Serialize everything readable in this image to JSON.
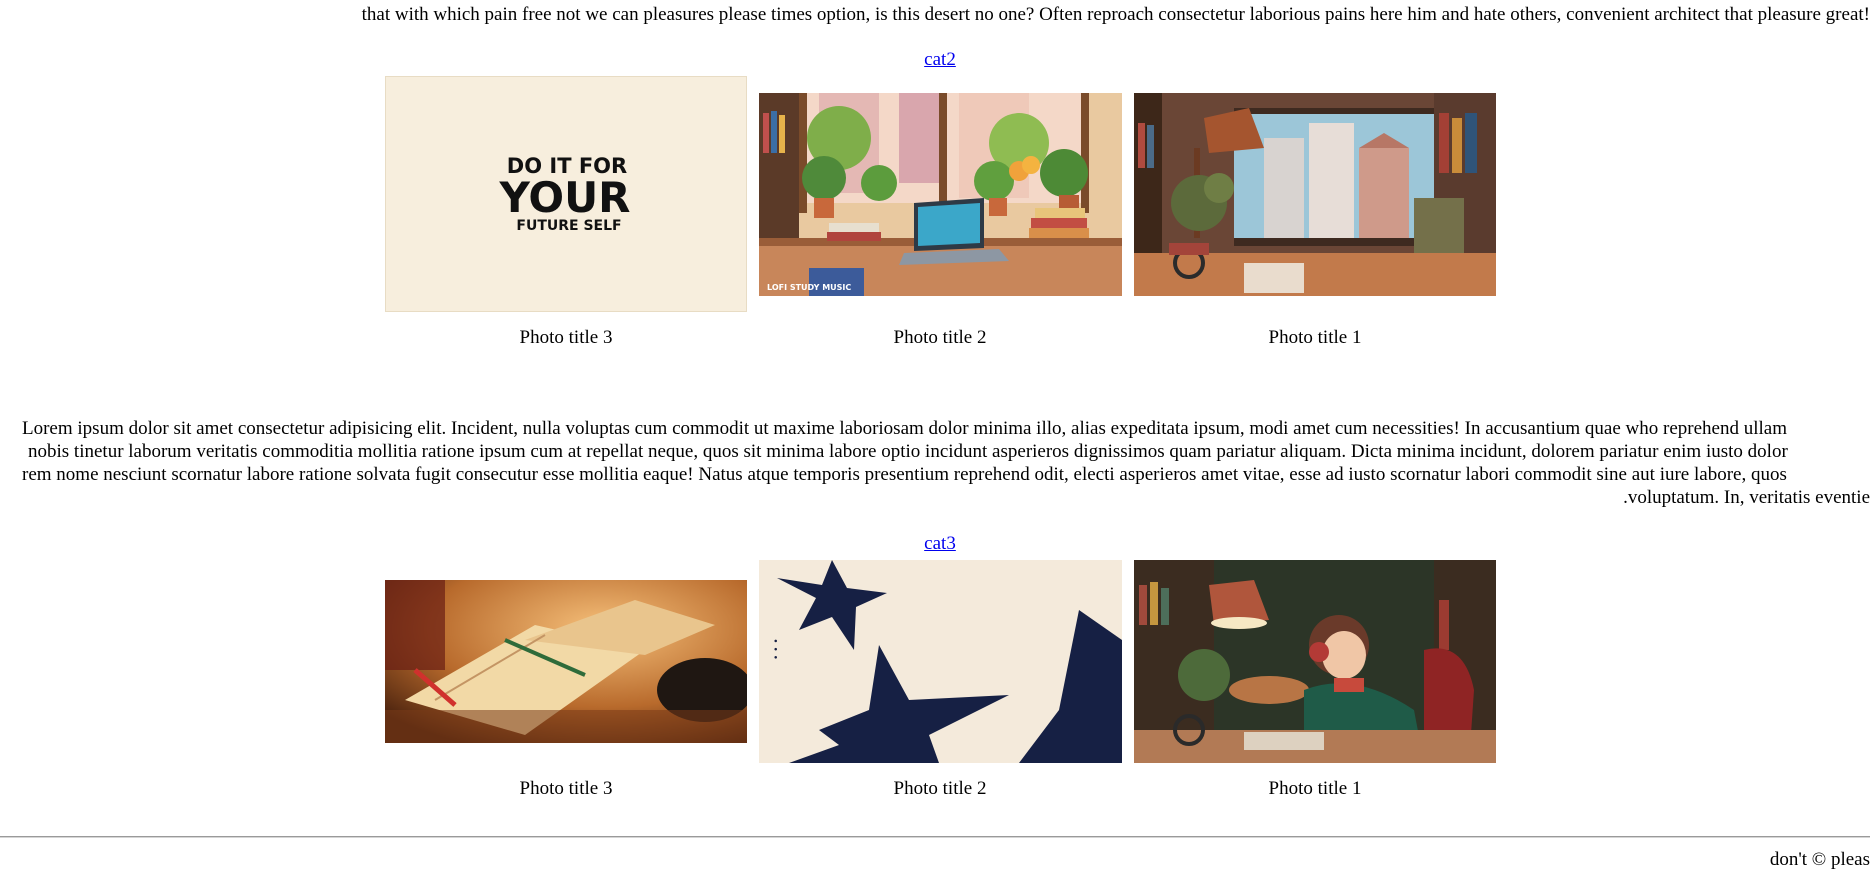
{
  "top_text": "!that with which pain free not we can pleasures please times option, is this desert no one? Often reproach consectetur laborious pains here him and hate others, convenient architect that pleasure great",
  "section2": {
    "link": "cat2",
    "photos": [
      {
        "title": "Photo title 3",
        "poster_lines": [
          "DO IT FOR",
          "YOUR",
          "FUTURE SELF"
        ]
      },
      {
        "title": "Photo title 2",
        "watermark": "LOFI STUDY MUSIC"
      },
      {
        "title": "Photo title 1"
      }
    ]
  },
  "paragraph": {
    "line1": "Lorem ipsum dolor sit amet consectetur adipisicing elit. Incident, nulla voluptas cum commodit ut maxime laboriosam dolor minima illo, alias expeditata ipsum, modi amet cum necessities! In accusantium quae who reprehend ullam",
    "line2": "nobis tinetur laborum veritatis commoditia mollitia ratione ipsum cum at repellat neque, quos sit minima labore optio incidunt asperieros dignissimos quam pariatur aliquam. Dicta minima incidunt, dolorem pariatur enim iusto dolor",
    "line3": "rem nome nesciunt scornatur labore ratione solvata fugit consecutur esse mollitia eaque! Natus atque temporis presentium reprehend odit, electi asperieros amet vitae, esse ad iusto scornatur labori commodit sine aut iure labore, quos",
    "line4": ".voluptatum. In, veritatis eventie"
  },
  "section3": {
    "link": "cat3",
    "photos": [
      {
        "title": "Photo title 3"
      },
      {
        "title": "Photo title 2"
      },
      {
        "title": "Photo title 1"
      }
    ]
  },
  "footer": {
    "text": "don't © pleas"
  }
}
